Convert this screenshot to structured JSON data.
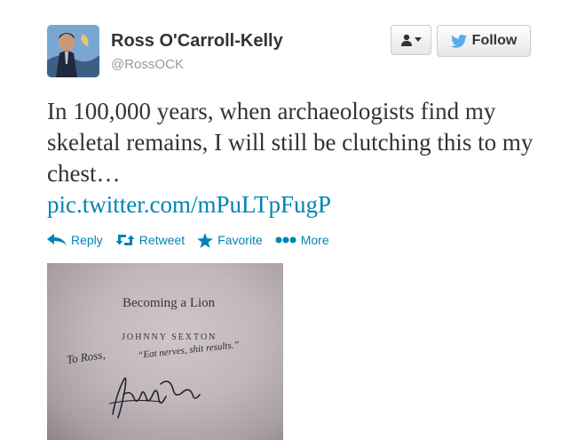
{
  "tweet": {
    "author_name": "Ross O'Carroll-Kelly",
    "author_handle": "@RossOCK",
    "text": "In 100,000 years, when archaeologists find my skeletal remains, I will still be clutching this to my chest…",
    "link": "pic.twitter.com/mPuLTpFugP"
  },
  "buttons": {
    "user_menu_icon": "person-icon",
    "follow_label": "Follow"
  },
  "actions": [
    {
      "label": "Reply",
      "icon": "reply-icon"
    },
    {
      "label": "Retweet",
      "icon": "retweet-icon"
    },
    {
      "label": "Favorite",
      "icon": "star-icon"
    },
    {
      "label": "More",
      "icon": "more-dots-icon"
    }
  ],
  "photo": {
    "book_title": "Becoming a Lion",
    "book_author": "JOHNNY SEXTON",
    "inscription_1": "To Ross,",
    "inscription_2": "“Eat nerves, shit results.”"
  },
  "colors": {
    "link": "#0084b4",
    "twitter_bird": "#55acee",
    "name_text": "#333333",
    "handle_text": "#999999"
  }
}
